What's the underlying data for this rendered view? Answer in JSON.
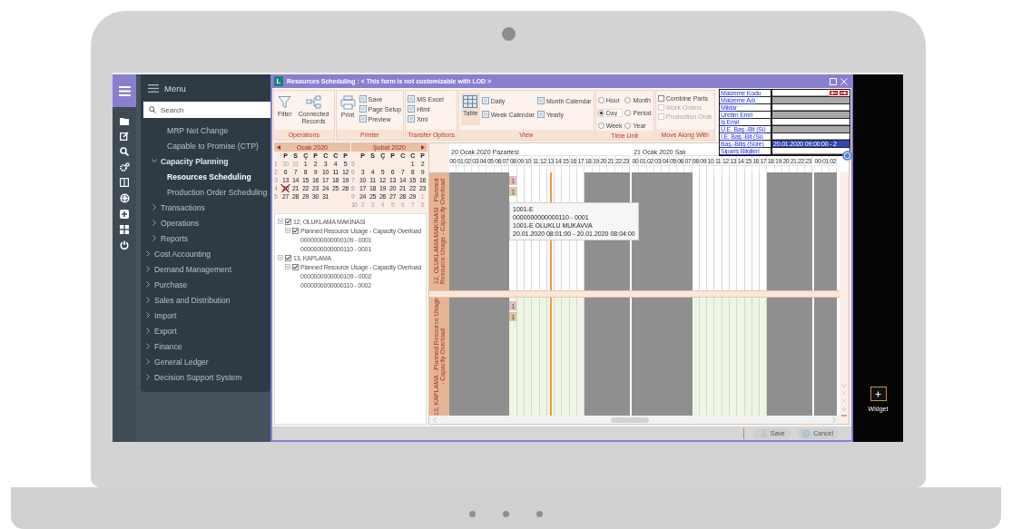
{
  "window": {
    "logo": "L",
    "title": "Resources Scheduling : < This form is not customizable with LOD >"
  },
  "menu": {
    "title": "Menu",
    "search": {
      "placeholder": "Search"
    },
    "items": [
      {
        "children": [
          {
            "children": [
              {
                "label": "MRP Net Change",
                "selected": false
              },
              {
                "label": "Capable to Promise (CTP)",
                "selected": false
              }
            ]
          },
          {
            "label": "Capacity Planning",
            "expanded": true,
            "selected": false,
            "children": [
              {
                "label": "Resources Scheduling",
                "selected": true
              },
              {
                "label": "Production Order Scheduling",
                "selected": false
              }
            ]
          },
          {
            "label": "Transactions",
            "expanded": false,
            "selected": false
          },
          {
            "label": "Operations",
            "expanded": false,
            "selected": false
          },
          {
            "label": "Reports",
            "expanded": false,
            "selected": false
          }
        ]
      },
      {
        "label": "Cost Accounting",
        "expanded": false,
        "selected": false
      },
      {
        "label": "Demand Management",
        "expanded": false,
        "selected": false
      },
      {
        "label": "Purchase",
        "expanded": false,
        "selected": false
      },
      {
        "label": "Sales and Distribution",
        "expanded": false,
        "selected": false
      },
      {
        "label": "Import",
        "expanded": false,
        "selected": false
      },
      {
        "label": "Export",
        "expanded": false,
        "selected": false
      },
      {
        "label": "Finance",
        "expanded": false,
        "selected": false
      },
      {
        "label": "General Ledger",
        "expanded": false,
        "selected": false
      },
      {
        "label": "Decision Support System",
        "expanded": false,
        "selected": false
      }
    ]
  },
  "ribbon": {
    "groups": [
      {
        "label": "Operations",
        "buttons": [
          {
            "label": "Filter"
          },
          {
            "label": "Connected Records"
          }
        ]
      },
      {
        "label": "Printer",
        "kind": "stack",
        "buttons": [
          {
            "label": "Print"
          }
        ],
        "items": [
          {
            "kind": "small",
            "label": "Save"
          },
          {
            "kind": "small",
            "label": "Page Setup"
          },
          {
            "kind": "small",
            "label": "Preview"
          }
        ]
      },
      {
        "label": "Transfer Options",
        "kind": "stack",
        "items": [
          {
            "kind": "small",
            "label": "MS Excel"
          },
          {
            "kind": "small",
            "label": "Html"
          },
          {
            "kind": "small",
            "label": "Xml"
          }
        ]
      },
      {
        "label": "View",
        "kind": "grid",
        "buttons": [
          {
            "label": "Table",
            "selected": true
          }
        ],
        "items": [
          {
            "kind": "small",
            "label": "Daily",
            "selected": false
          },
          {
            "kind": "small",
            "label": "Month Calendar",
            "selected": false
          },
          {
            "kind": "small",
            "label": "Week Calendar",
            "selected": false
          },
          {
            "kind": "small",
            "label": "Yearly",
            "selected": false
          }
        ]
      },
      {
        "label": "Time Unit",
        "kind": "grid",
        "items": [
          {
            "kind": "radio",
            "label": "Hour",
            "selected": false
          },
          {
            "kind": "radio",
            "label": "Month",
            "selected": false
          },
          {
            "kind": "radio",
            "label": "Day",
            "selected": true
          },
          {
            "kind": "radio",
            "label": "Period",
            "selected": false
          },
          {
            "kind": "radio",
            "label": "Week",
            "selected": false
          },
          {
            "kind": "radio",
            "label": "Year",
            "selected": false
          }
        ]
      },
      {
        "label": "Move Along With",
        "kind": "stack",
        "items": [
          {
            "kind": "check",
            "label": "Combine Parts",
            "checked": false,
            "disabled": false
          },
          {
            "kind": "check",
            "label": "Work Orders",
            "checked": false,
            "disabled": true
          },
          {
            "kind": "check",
            "label": "Production Orde",
            "checked": false,
            "disabled": true
          }
        ]
      }
    ]
  },
  "calendar": {
    "months": [
      {
        "title": "Ocak 2020",
        "weekdays": [
          "P",
          "S",
          "Ç",
          "P",
          "C",
          "C",
          "P"
        ],
        "weeks": [
          {
            "num": "1",
            "days": [
              {
                "d": "30",
                "muted": true,
                "today": false
              },
              {
                "d": "31",
                "muted": true,
                "today": false
              },
              {
                "d": "1",
                "muted": false,
                "today": false
              },
              {
                "d": "2",
                "muted": false,
                "today": false
              },
              {
                "d": "3",
                "muted": false,
                "today": false
              },
              {
                "d": "4",
                "muted": false,
                "today": false
              },
              {
                "d": "5",
                "muted": false,
                "today": false
              }
            ]
          },
          {
            "num": "2",
            "days": [
              {
                "d": "6",
                "muted": false,
                "today": false
              },
              {
                "d": "7",
                "muted": false,
                "today": false
              },
              {
                "d": "8",
                "muted": false,
                "today": false
              },
              {
                "d": "9",
                "muted": false,
                "today": false
              },
              {
                "d": "10",
                "muted": false,
                "today": false
              },
              {
                "d": "11",
                "muted": false,
                "today": false
              },
              {
                "d": "12",
                "muted": false,
                "today": false
              }
            ]
          },
          {
            "num": "3",
            "days": [
              {
                "d": "13",
                "muted": false,
                "today": false
              },
              {
                "d": "14",
                "muted": false,
                "today": false
              },
              {
                "d": "15",
                "muted": false,
                "today": false
              },
              {
                "d": "16",
                "muted": false,
                "today": false
              },
              {
                "d": "17",
                "muted": false,
                "today": false
              },
              {
                "d": "18",
                "muted": false,
                "today": false
              },
              {
                "d": "19",
                "muted": false,
                "today": false
              }
            ]
          },
          {
            "num": "4",
            "days": [
              {
                "d": "20",
                "muted": false,
                "today": true
              },
              {
                "d": "21",
                "muted": false,
                "today": false
              },
              {
                "d": "22",
                "muted": false,
                "today": false
              },
              {
                "d": "23",
                "muted": false,
                "today": false
              },
              {
                "d": "24",
                "muted": false,
                "today": false
              },
              {
                "d": "25",
                "muted": false,
                "today": false
              },
              {
                "d": "26",
                "muted": false,
                "today": false
              }
            ]
          },
          {
            "num": "5",
            "days": [
              {
                "d": "27",
                "muted": false,
                "today": false
              },
              {
                "d": "28",
                "muted": false,
                "today": false
              },
              {
                "d": "29",
                "muted": false,
                "today": false
              },
              {
                "d": "30",
                "muted": false,
                "today": false
              },
              {
                "d": "31",
                "muted": false,
                "today": false
              }
            ]
          }
        ]
      },
      {
        "title": "Şubat 2020",
        "weekdays": [
          "P",
          "S",
          "Ç",
          "P",
          "C",
          "C",
          "P"
        ],
        "weeks": [
          {
            "num": "5",
            "days": [
              {
                "d": "1",
                "muted": false,
                "today": false
              },
              {
                "d": "2",
                "muted": false,
                "today": false
              }
            ]
          },
          {
            "num": "6",
            "days": [
              {
                "d": "3",
                "muted": false,
                "today": false
              },
              {
                "d": "4",
                "muted": false,
                "today": false
              },
              {
                "d": "5",
                "muted": false,
                "today": false
              },
              {
                "d": "6",
                "muted": false,
                "today": false
              },
              {
                "d": "7",
                "muted": false,
                "today": false
              },
              {
                "d": "8",
                "muted": false,
                "today": false
              },
              {
                "d": "9",
                "muted": false,
                "today": false
              }
            ]
          },
          {
            "num": "7",
            "days": [
              {
                "d": "10",
                "muted": false,
                "today": false
              },
              {
                "d": "11",
                "muted": false,
                "today": false
              },
              {
                "d": "12",
                "muted": false,
                "today": false
              },
              {
                "d": "13",
                "muted": false,
                "today": false
              },
              {
                "d": "14",
                "muted": false,
                "today": false
              },
              {
                "d": "15",
                "muted": false,
                "today": false
              },
              {
                "d": "16",
                "muted": false,
                "today": false
              }
            ]
          },
          {
            "num": "8",
            "days": [
              {
                "d": "17",
                "muted": false,
                "today": false
              },
              {
                "d": "18",
                "muted": false,
                "today": false
              },
              {
                "d": "19",
                "muted": false,
                "today": false
              },
              {
                "d": "20",
                "muted": false,
                "today": false
              },
              {
                "d": "21",
                "muted": false,
                "today": false
              },
              {
                "d": "22",
                "muted": false,
                "today": false
              },
              {
                "d": "23",
                "muted": false,
                "today": false
              }
            ]
          },
          {
            "num": "9",
            "days": [
              {
                "d": "24",
                "muted": false,
                "today": false
              },
              {
                "d": "25",
                "muted": false,
                "today": false
              },
              {
                "d": "26",
                "muted": false,
                "today": false
              },
              {
                "d": "27",
                "muted": false,
                "today": false
              },
              {
                "d": "28",
                "muted": false,
                "today": false
              },
              {
                "d": "29",
                "muted": false,
                "today": false
              },
              {
                "d": "1",
                "muted": true,
                "today": false
              }
            ]
          },
          {
            "num": "10",
            "days": [
              {
                "d": "2",
                "muted": true,
                "today": false
              },
              {
                "d": "3",
                "muted": true,
                "today": false
              },
              {
                "d": "4",
                "muted": true,
                "today": false
              },
              {
                "d": "5",
                "muted": true,
                "today": false
              },
              {
                "d": "6",
                "muted": true,
                "today": false
              },
              {
                "d": "7",
                "muted": true,
                "today": false
              },
              {
                "d": "8",
                "muted": true,
                "today": false
              }
            ]
          }
        ]
      }
    ]
  },
  "tree": [
    {
      "label": "12, OLUKLAMA MAKİNASI",
      "checked": true,
      "expanded": true,
      "children": [
        {
          "label": "Planned Resource Usage - Capacity Overload",
          "checked": true,
          "expanded": true,
          "children": [
            {
              "label": "0000000000000109 - 0001"
            },
            {
              "label": "0000000000000110 - 0001"
            }
          ]
        }
      ]
    },
    {
      "label": "13, KAPLAMA",
      "checked": true,
      "expanded": true,
      "children": [
        {
          "label": "Planned Resource Usage - Capacity Overload",
          "checked": true,
          "expanded": true,
          "children": [
            {
              "label": "0000000000000109 - 0002"
            },
            {
              "label": "0000000000000110 - 0002"
            }
          ]
        }
      ]
    }
  ],
  "gantt": {
    "days": [
      {
        "label": "20 Ocak 2020 Pazartesi",
        "hours": [
          {
            "h": "00",
            "working": false,
            "current": false
          },
          {
            "h": "01",
            "working": false,
            "current": false
          },
          {
            "h": "02",
            "working": false,
            "current": false
          },
          {
            "h": "03",
            "working": false,
            "current": false
          },
          {
            "h": "04",
            "working": false,
            "current": false
          },
          {
            "h": "05",
            "working": false,
            "current": false
          },
          {
            "h": "06",
            "working": false,
            "current": false
          },
          {
            "h": "07",
            "working": false,
            "current": false
          },
          {
            "h": "08",
            "working": true,
            "current": false
          },
          {
            "h": "09",
            "working": true,
            "current": false
          },
          {
            "h": "10",
            "working": true,
            "current": false
          },
          {
            "h": "11",
            "working": true,
            "current": false
          },
          {
            "h": "12",
            "working": true,
            "current": false
          },
          {
            "h": "13",
            "working": true,
            "current": true
          },
          {
            "h": "14",
            "working": true,
            "current": false
          },
          {
            "h": "15",
            "working": true,
            "current": false
          },
          {
            "h": "16",
            "working": true,
            "current": false
          },
          {
            "h": "17",
            "working": true,
            "current": false
          },
          {
            "h": "18",
            "working": false,
            "current": false
          },
          {
            "h": "19",
            "working": false,
            "current": false
          },
          {
            "h": "20",
            "working": false,
            "current": false
          },
          {
            "h": "21",
            "working": false,
            "current": false
          },
          {
            "h": "22",
            "working": false,
            "current": false
          },
          {
            "h": "23",
            "working": false,
            "current": false
          }
        ]
      },
      {
        "label": "21 Ocak 2020 Salı",
        "hours": [
          {
            "h": "00",
            "working": false,
            "current": false
          },
          {
            "h": "01",
            "working": false,
            "current": false
          },
          {
            "h": "02",
            "working": false,
            "current": false
          },
          {
            "h": "03",
            "working": false,
            "current": false
          },
          {
            "h": "04",
            "working": false,
            "current": false
          },
          {
            "h": "05",
            "working": false,
            "current": false
          },
          {
            "h": "06",
            "working": false,
            "current": false
          },
          {
            "h": "07",
            "working": false,
            "current": false
          },
          {
            "h": "08",
            "working": true,
            "current": false
          },
          {
            "h": "09",
            "working": true,
            "current": false
          },
          {
            "h": "10",
            "working": true,
            "current": false
          },
          {
            "h": "11",
            "working": true,
            "current": false
          },
          {
            "h": "12",
            "working": true,
            "current": false
          },
          {
            "h": "13",
            "working": true,
            "current": false
          },
          {
            "h": "14",
            "working": true,
            "current": false
          },
          {
            "h": "15",
            "working": true,
            "current": false
          },
          {
            "h": "16",
            "working": true,
            "current": false
          },
          {
            "h": "17",
            "working": true,
            "current": false
          },
          {
            "h": "18",
            "working": false,
            "current": false
          },
          {
            "h": "19",
            "working": false,
            "current": false
          },
          {
            "h": "20",
            "working": false,
            "current": false
          },
          {
            "h": "21",
            "working": false,
            "current": false
          },
          {
            "h": "22",
            "working": false,
            "current": false
          },
          {
            "h": "23",
            "working": false,
            "current": false
          }
        ]
      },
      {
        "hours": [
          {
            "h": "00",
            "working": false,
            "current": false
          },
          {
            "h": "01",
            "working": false,
            "current": false
          },
          {
            "h": "02",
            "working": false,
            "current": false
          }
        ]
      }
    ],
    "resources": [
      {
        "label": "12, OLUKLAMA MAKİNASI : Planned Resource Usage - Capacity Overload",
        "color": "#ffffff",
        "tasks": [
          {
            "label": "1",
            "color": "#e9b9bb"
          },
          {
            "label": "1",
            "color": "#dcc49f"
          }
        ]
      },
      {
        "label": "13, KAPLAMA : Planned Resource Usage - Capacity Overload",
        "color": "#eef6e3",
        "tasks": [
          {
            "label": "1",
            "color": "#e9b9bb"
          },
          {
            "label": "1",
            "color": "#dcc49f"
          }
        ]
      }
    ],
    "tooltip": [
      "1001-E",
      "0000000000000110 - 0001",
      "1001-E OLUKLU MUKAVVA",
      "20.01.2020 08:01:00 - 20.01.2020 08:04:00"
    ]
  },
  "info_panel": {
    "fields": [
      {
        "label": "Malzeme Kodu",
        "shaded": false,
        "selected": false
      },
      {
        "label": "Malzeme Adı",
        "shaded": true,
        "selected": false
      },
      {
        "label": "Miktar",
        "shaded": false,
        "selected": false
      },
      {
        "label": "Uretim Emri",
        "shaded": true,
        "selected": false
      },
      {
        "label": "İş Emri",
        "shaded": false,
        "selected": false
      },
      {
        "label": "Ü.E. Baş.-Bit (Sü",
        "shaded": true,
        "selected": false
      },
      {
        "label": "İ.E. Baş.-Bit (Sü",
        "shaded": false,
        "selected": false
      },
      {
        "label": "Baş.-Bitiş (Süre)",
        "shaded": false,
        "selected": true,
        "value": "20.01.2020 09:00:00 - 2"
      },
      {
        "label": "Siparis Bilgileri",
        "shaded": false,
        "selected": false
      }
    ]
  },
  "footer": {
    "buttons": [
      {
        "label": "Save"
      },
      {
        "label": "Cancel"
      }
    ]
  },
  "widget": {
    "label": "Widget"
  }
}
